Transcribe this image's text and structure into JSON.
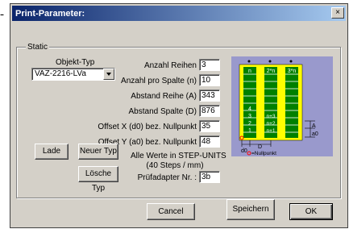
{
  "outside_text": "-",
  "dialog": {
    "title": "Print-Parameter:",
    "close_label": "×"
  },
  "group": {
    "label": "Static"
  },
  "objekt_typ": {
    "label": "Objekt-Typ",
    "value": "VAZ-2216-LVa"
  },
  "fields": {
    "anzahl_reihen": {
      "label": "Anzahl Reihen",
      "value": "3"
    },
    "anzahl_pro_spalte": {
      "label": "Anzahl pro Spalte (n)",
      "value": "10"
    },
    "abstand_reihe": {
      "label": "Abstand Reihe (A)",
      "value": "343"
    },
    "abstand_spalte": {
      "label": "Abstand Spalte (D)",
      "value": "876"
    },
    "offset_x": {
      "label": "Offset X (d0) bez. Nullpunkt",
      "value": "35"
    },
    "offset_y": {
      "label": "Offset Y (a0) bez. Nullpunkt",
      "value": "48"
    },
    "pruefadapter": {
      "label": "Prüfadapter Nr. :",
      "value": "3b"
    }
  },
  "info": {
    "line1": "Alle Werte in STEP-UNITS",
    "line2": "(40 Steps / mm)"
  },
  "buttons": {
    "lade": "Lade",
    "neuer_typ": "Neuer Typ",
    "loesche_typ": "Lösche Typ",
    "cancel": "Cancel",
    "speichern": "Speichern",
    "ok": "OK"
  },
  "diagram": {
    "col1_top": "n",
    "col2_top": "2*n",
    "col3_top": "3*n",
    "col1_numbers": [
      "4",
      "3",
      "2",
      "1"
    ],
    "col2_numbers": [
      "n+3",
      "n+2",
      "n+1"
    ],
    "label_A": "A",
    "label_a0": "a0",
    "label_D": "D",
    "label_d0": "d0",
    "nullpunkt": "=Nullpunkt",
    "colors": {
      "background": "#9999cc",
      "board": "#ffff00",
      "column": "#008000",
      "row_line": "#ffffff",
      "nullpunkt": "#ff0000"
    }
  }
}
